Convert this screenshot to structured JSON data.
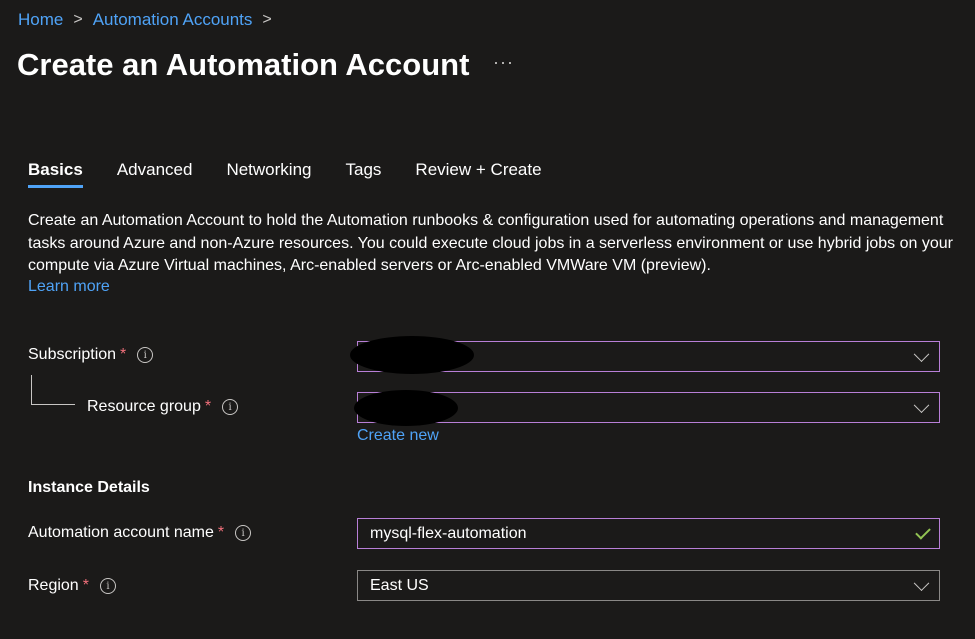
{
  "breadcrumb": {
    "items": [
      "Home",
      "Automation Accounts"
    ],
    "separator": ">"
  },
  "page": {
    "title": "Create an Automation Account",
    "more_label": "···"
  },
  "tabs": [
    {
      "label": "Basics",
      "active": true
    },
    {
      "label": "Advanced",
      "active": false
    },
    {
      "label": "Networking",
      "active": false
    },
    {
      "label": "Tags",
      "active": false
    },
    {
      "label": "Review + Create",
      "active": false
    }
  ],
  "description": {
    "text": "Create an Automation Account to hold the Automation runbooks & configuration used for automating operations and management tasks around Azure and non-Azure resources. You could execute cloud jobs in a serverless environment or use hybrid jobs on your compute via Azure Virtual machines, Arc-enabled servers or Arc-enabled VMWare VM (preview).",
    "learn_more": "Learn more"
  },
  "form": {
    "required_marker": "*",
    "info_glyph": "i",
    "subscription": {
      "label": "Subscription",
      "value": ""
    },
    "resource_group": {
      "label": "Resource group",
      "value": "",
      "create_new": "Create new"
    },
    "instance_details_title": "Instance Details",
    "account_name": {
      "label": "Automation account name",
      "value": "mysql-flex-automation"
    },
    "region": {
      "label": "Region",
      "value": "East US"
    }
  },
  "colors": {
    "background": "#1b1a19",
    "link": "#4fa3f7",
    "required": "#f1707b",
    "focus_border": "#b87fd7",
    "valid_check": "#92c353"
  },
  "icons": [
    "chevron-right-icon",
    "more-icon",
    "info-icon",
    "chevron-down-icon",
    "checkmark-icon"
  ]
}
